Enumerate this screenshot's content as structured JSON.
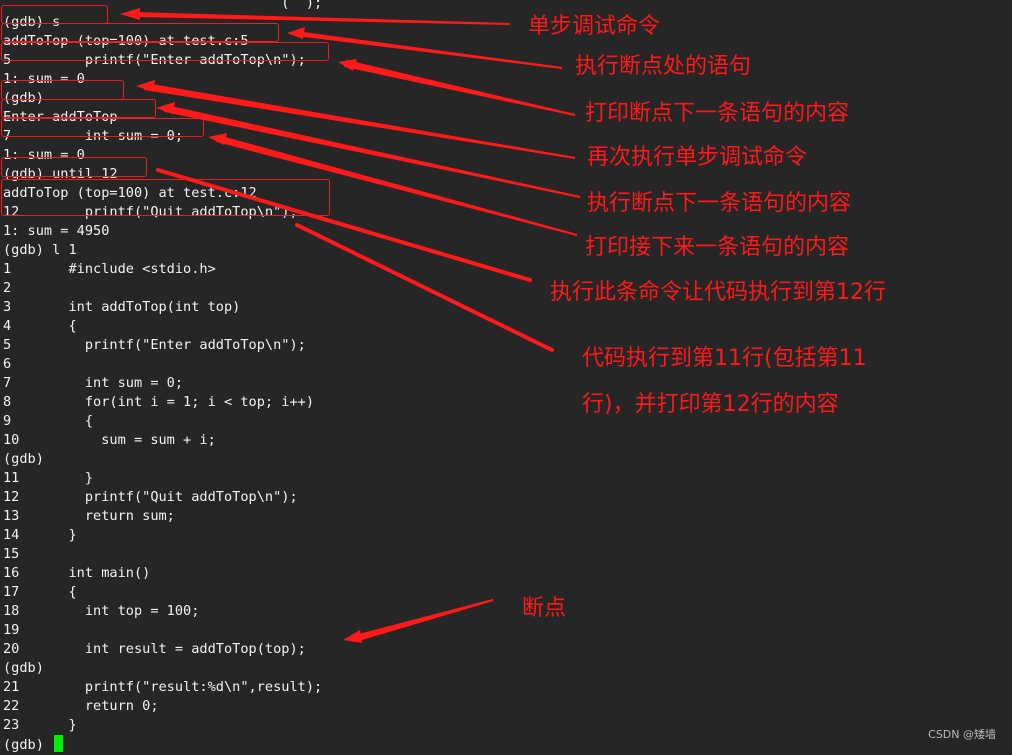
{
  "terminal": {
    "lines": [
      "                                  (  );",
      "(gdb) s",
      "addToTop (top=100) at test.c:5",
      "5         printf(\"Enter addToTop\\n\");",
      "1: sum = 0",
      "(gdb)",
      "Enter addToTop",
      "7         int sum = 0;",
      "1: sum = 0",
      "(gdb) until 12",
      "addToTop (top=100) at test.c:12",
      "12        printf(\"Quit addToTop\\n\");",
      "1: sum = 4950",
      "(gdb) l 1",
      "1       #include <stdio.h>",
      "2",
      "3       int addToTop(int top)",
      "4       {",
      "5         printf(\"Enter addToTop\\n\");",
      "6",
      "7         int sum = 0;",
      "8         for(int i = 1; i < top; i++)",
      "9         {",
      "10          sum = sum + i;",
      "(gdb)",
      "11        }",
      "12        printf(\"Quit addToTop\\n\");",
      "13        return sum;",
      "14      }",
      "15",
      "16      int main()",
      "17      {",
      "18        int top = 100;",
      "19",
      "20        int result = addToTop(top);",
      "(gdb)",
      "21        printf(\"result:%d\\n\",result);",
      "22        return 0;",
      "23      }",
      "(gdb) "
    ],
    "cursor_color": "#00ee00"
  },
  "annotations": [
    {
      "id": "step-command",
      "text": "单步调试命令"
    },
    {
      "id": "execute-breakpoint-statement",
      "text": "执行断点处的语句"
    },
    {
      "id": "print-next-statement",
      "text": "打印断点下一条语句的内容"
    },
    {
      "id": "step-again",
      "text": "再次执行单步调试命令"
    },
    {
      "id": "execute-next-statement",
      "text": "执行断点下一条语句的内容"
    },
    {
      "id": "print-following-statement",
      "text": "打印接下来一条语句的内容"
    },
    {
      "id": "until-command",
      "text": "执行此条命令让代码执行到第12行"
    },
    {
      "id": "until-result",
      "text": "代码执行到第11行(包括第11行)，并打印第12行的内容"
    },
    {
      "id": "breakpoint",
      "text": "断点"
    }
  ],
  "annotation_color": "#ff1a1a",
  "watermark": "CSDN @矮墙"
}
